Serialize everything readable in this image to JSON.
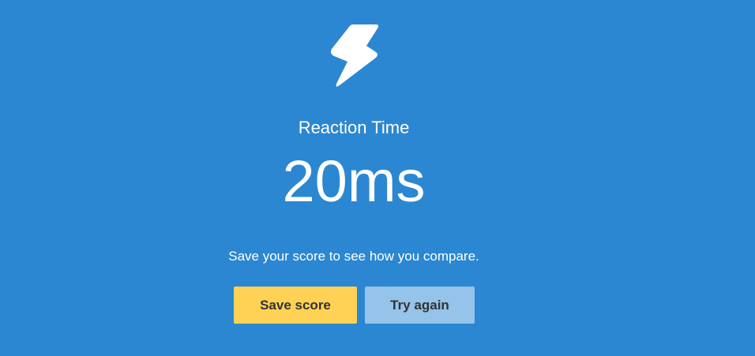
{
  "header": {
    "icon": "lightning-bolt-icon"
  },
  "result": {
    "label": "Reaction Time",
    "score": "20ms",
    "subtitle": "Save your score to see how you compare."
  },
  "actions": {
    "save_label": "Save score",
    "retry_label": "Try again"
  },
  "colors": {
    "background": "#2b87d1",
    "save_button": "#ffd154",
    "retry_button": "#95c3ea",
    "text": "#ffffff"
  }
}
